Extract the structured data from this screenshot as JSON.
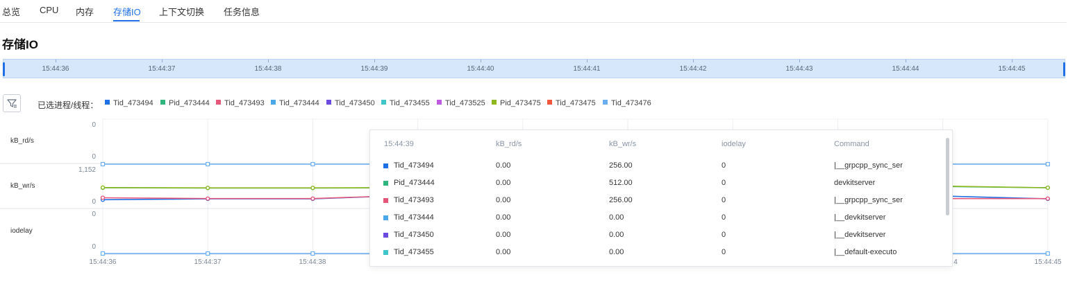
{
  "tabs": [
    {
      "label": "总览"
    },
    {
      "label": "CPU"
    },
    {
      "label": "内存"
    },
    {
      "label": "存储IO"
    },
    {
      "label": "上下文切换"
    },
    {
      "label": "任务信息"
    }
  ],
  "active_tab": "存储IO",
  "page_title": "存储IO",
  "time_brush": {
    "labels": [
      "15:44:36",
      "15:44:37",
      "15:44:38",
      "15:44:39",
      "15:44:40",
      "15:44:41",
      "15:44:42",
      "15:44:43",
      "15:44:44",
      "15:44:45"
    ]
  },
  "filter": {
    "icon": "filter-icon"
  },
  "legend": {
    "label": "已选进程/线程：",
    "items": [
      {
        "name": "Tid_473494",
        "color": "#1f6fe5"
      },
      {
        "name": "Pid_473444",
        "color": "#2fb57d"
      },
      {
        "name": "Tid_473493",
        "color": "#e4577b"
      },
      {
        "name": "Tid_473444",
        "color": "#4aa8e8"
      },
      {
        "name": "Tid_473450",
        "color": "#6b4be0"
      },
      {
        "name": "Tid_473455",
        "color": "#40c5c8"
      },
      {
        "name": "Tid_473525",
        "color": "#bf59e0"
      },
      {
        "name": "Pid_473475",
        "color": "#8fb820"
      },
      {
        "name": "Tid_473475",
        "color": "#f0573a"
      },
      {
        "name": "Tid_473476",
        "color": "#6aaef0"
      }
    ]
  },
  "rows": [
    {
      "label": "kB_rd/s",
      "ymax_label": "0",
      "ymin_label": "0"
    },
    {
      "label": "kB_wr/s",
      "ymax_label": "1,152",
      "ymin_label": "0"
    },
    {
      "label": "iodelay",
      "ymax_label": "0",
      "ymin_label": "0"
    }
  ],
  "x_ticks": [
    "15:44:36",
    "15:44:37",
    "15:44:38",
    "4",
    "15:44:45"
  ],
  "chart_data": {
    "type": "line",
    "x": [
      "15:44:36",
      "15:44:37",
      "15:44:38",
      "15:44:39",
      "15:44:40",
      "15:44:41",
      "15:44:42",
      "15:44:43",
      "15:44:44",
      "15:44:45"
    ],
    "panels": [
      {
        "ylabel": "kB_rd/s",
        "ylim": [
          0,
          0
        ],
        "series": [
          {
            "name": "Tid_473476",
            "values": [
              0,
              0,
              0,
              0,
              0,
              0,
              0,
              0,
              0,
              0
            ]
          }
        ]
      },
      {
        "ylabel": "kB_wr/s",
        "ylim": [
          0,
          1152
        ],
        "series": [
          {
            "name": "Tid_473494",
            "values": [
              90,
              120,
              120,
              256,
              256,
              256,
              256,
              256,
              220,
              120
            ]
          },
          {
            "name": "Pid_473444",
            "values": [
              512,
              505,
              505,
              512,
              512,
              512,
              512,
              512,
              560,
              512
            ]
          },
          {
            "name": "Tid_473493",
            "values": [
              160,
              130,
              130,
              256,
              256,
              256,
              256,
              256,
              130,
              130
            ]
          },
          {
            "name": "Pid_473475",
            "values": [
              520,
              510,
              510,
              520,
              520,
              520,
              520,
              520,
              570,
              515
            ]
          }
        ]
      },
      {
        "ylabel": "iodelay",
        "ylim": [
          0,
          0
        ],
        "series": [
          {
            "name": "Tid_473476",
            "values": [
              0,
              0,
              0,
              0,
              0,
              0,
              0,
              0,
              0,
              0
            ]
          }
        ]
      }
    ]
  },
  "tooltip": {
    "headers": [
      "15:44:39",
      "kB_rd/s",
      "kB_wr/s",
      "iodelay",
      "Command"
    ],
    "rows": [
      {
        "name": "Tid_473494",
        "color": "#1f6fe5",
        "rd": "0.00",
        "wr": "256.00",
        "iodelay": "0",
        "command": "|__grpcpp_sync_ser"
      },
      {
        "name": "Pid_473444",
        "color": "#2fb57d",
        "rd": "0.00",
        "wr": "512.00",
        "iodelay": "0",
        "command": "devkitserver"
      },
      {
        "name": "Tid_473493",
        "color": "#e4577b",
        "rd": "0.00",
        "wr": "256.00",
        "iodelay": "0",
        "command": "|__grpcpp_sync_ser"
      },
      {
        "name": "Tid_473444",
        "color": "#4aa8e8",
        "rd": "0.00",
        "wr": "0.00",
        "iodelay": "0",
        "command": "|__devkitserver"
      },
      {
        "name": "Tid_473450",
        "color": "#6b4be0",
        "rd": "0.00",
        "wr": "0.00",
        "iodelay": "0",
        "command": "|__devkitserver"
      },
      {
        "name": "Tid_473455",
        "color": "#40c5c8",
        "rd": "0.00",
        "wr": "0.00",
        "iodelay": "0",
        "command": "|__default-executo"
      }
    ]
  }
}
